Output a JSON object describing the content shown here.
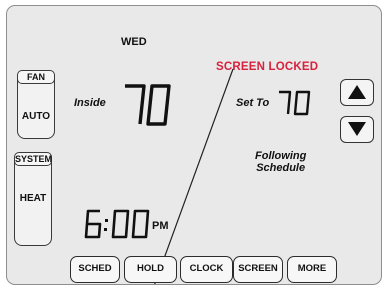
{
  "thermostat": {
    "day": "WED",
    "status": "SCREEN LOCKED",
    "inside_label": "Inside",
    "inside_temp": "70",
    "set_label": "Set To",
    "set_temp": "70",
    "schedule_text_line1": "Following",
    "schedule_text_line2": "Schedule",
    "time": "6:00",
    "time_period": "PM"
  },
  "fan": {
    "label": "FAN",
    "value": "AUTO"
  },
  "system": {
    "label": "SYSTEM",
    "value": "HEAT"
  },
  "bottom_buttons": {
    "sched": "SCHED",
    "hold": "HOLD",
    "clock": "CLOCK",
    "screen": "SCREEN",
    "more": "MORE"
  },
  "icons": {
    "up": "up-arrow-icon",
    "down": "down-arrow-icon"
  },
  "colors": {
    "screen_bg": "#e9e9e9",
    "locked_text": "#d8213d",
    "segment": "#111111"
  }
}
